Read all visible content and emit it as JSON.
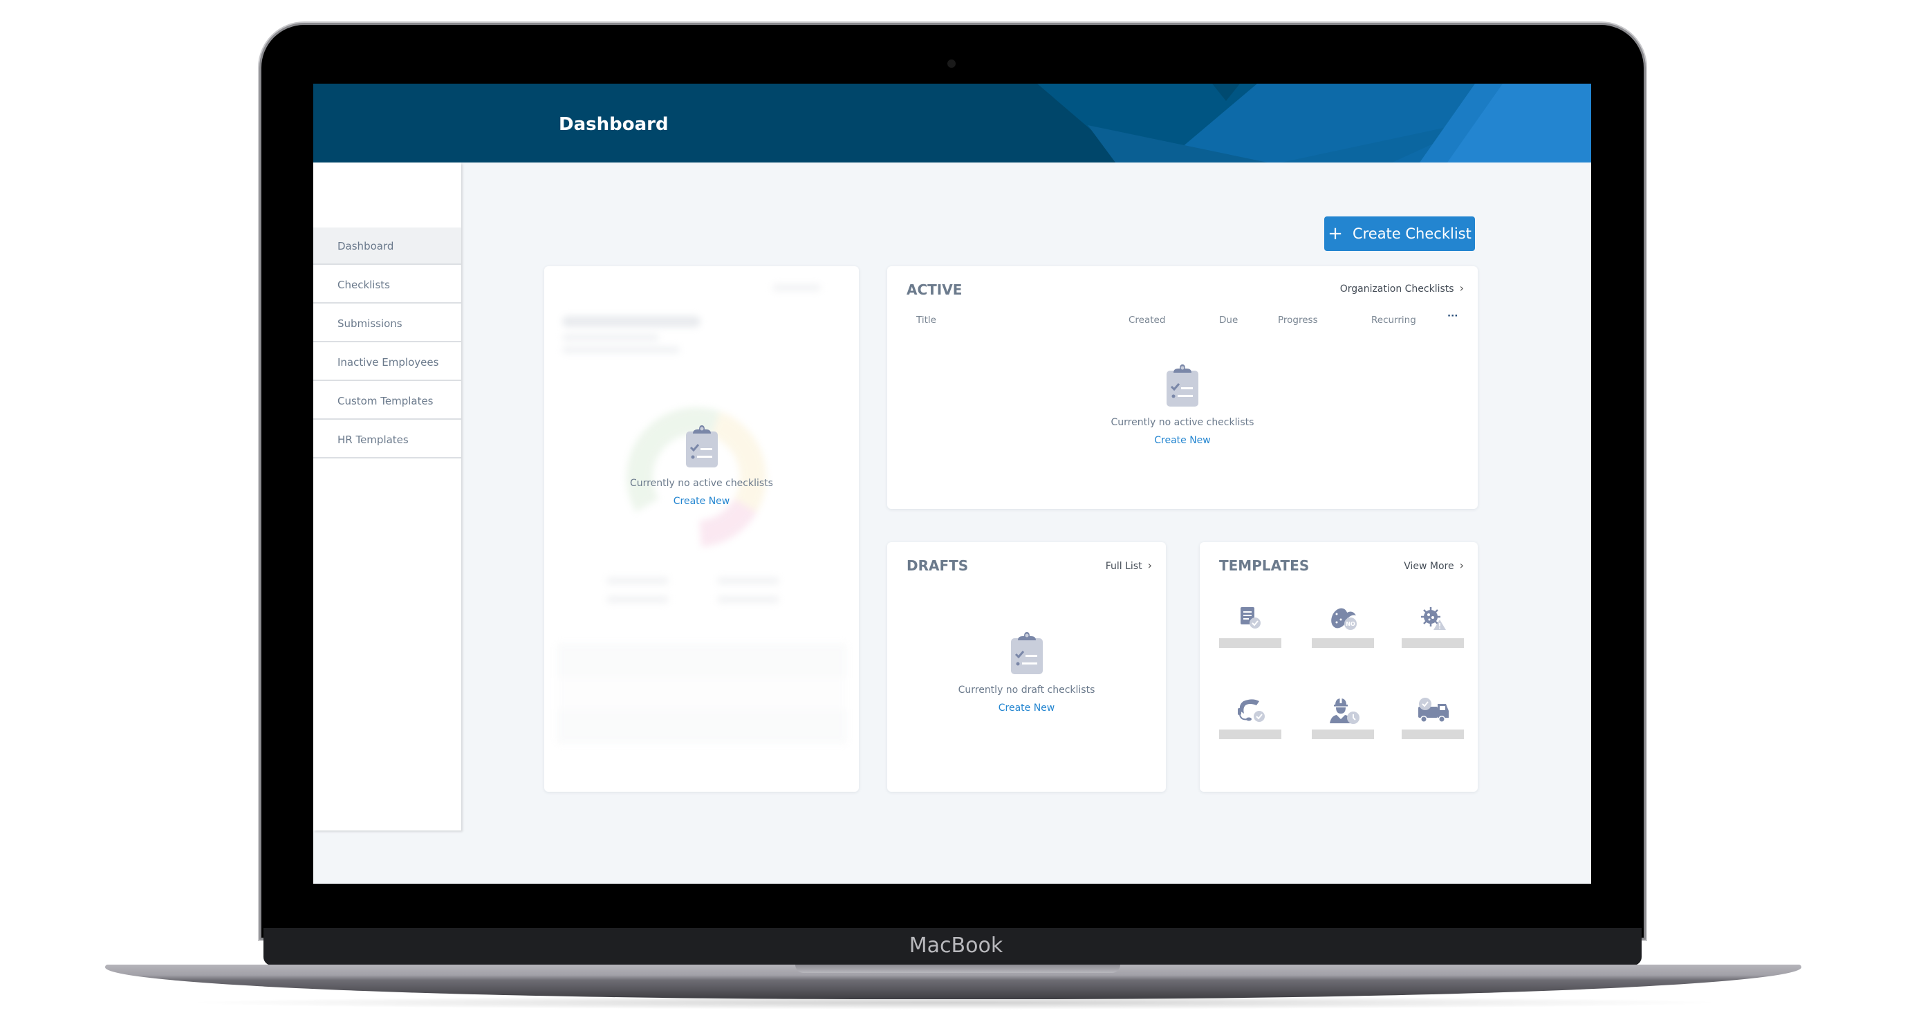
{
  "device": {
    "brand_label": "MacBook"
  },
  "header": {
    "title": "Dashboard"
  },
  "colors": {
    "header_bg": "#00466a",
    "accent": "#2385d0",
    "page_bg": "#f3f6f9",
    "muted_text": "#6b7a8c",
    "icon_fill": "#7a87a8",
    "icon_light": "#c9cedb"
  },
  "sidebar": {
    "items": [
      {
        "label": "Dashboard",
        "active": true
      },
      {
        "label": "Checklists"
      },
      {
        "label": "Submissions"
      },
      {
        "label": "Inactive Employees"
      },
      {
        "label": "Custom Templates"
      },
      {
        "label": "HR Templates"
      }
    ]
  },
  "toolbar": {
    "create_checklist_label": "Create Checklist",
    "create_checklist_icon": "plus-icon"
  },
  "overview_card": {
    "empty_text": "Currently no active checklists",
    "create_new_label": "Create New",
    "blurred": true
  },
  "active_card": {
    "title": "ACTIVE",
    "link_label": "Organization Checklists",
    "columns": [
      "Title",
      "Created",
      "Due",
      "Progress",
      "Recurring"
    ],
    "more_icon": "ellipsis-icon",
    "empty_text": "Currently no active checklists",
    "create_new_label": "Create New"
  },
  "drafts_card": {
    "title": "DRAFTS",
    "link_label": "Full List",
    "empty_text": "Currently no draft checklists",
    "create_new_label": "Create New"
  },
  "templates_card": {
    "title": "TEMPLATES",
    "link_label": "View More",
    "templates": [
      {
        "icon": "document-check-icon"
      },
      {
        "icon": "no-peanut-icon"
      },
      {
        "icon": "virus-warning-icon"
      },
      {
        "icon": "headset-support-icon"
      },
      {
        "icon": "worker-clock-icon"
      },
      {
        "icon": "truck-check-icon"
      }
    ]
  }
}
